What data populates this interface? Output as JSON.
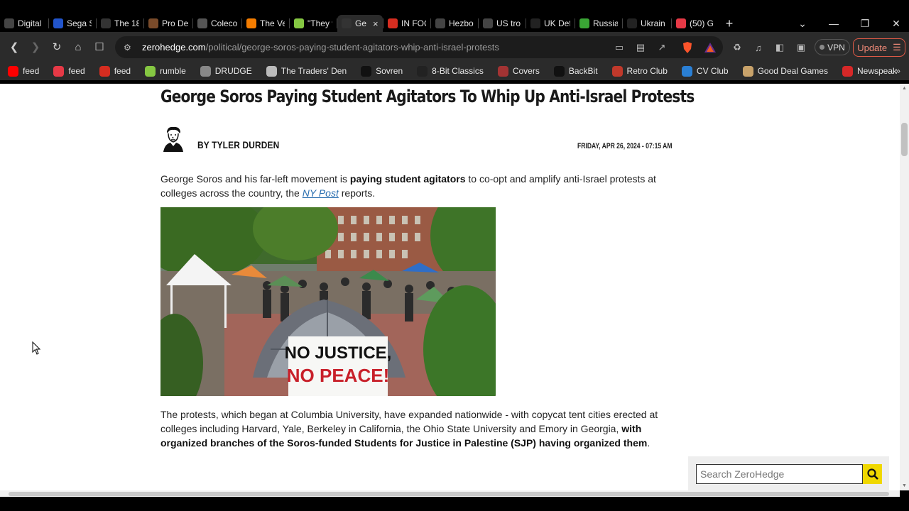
{
  "browser": {
    "tabs": [
      {
        "label": "Digital",
        "icon": "reader-icon",
        "color": "#444444"
      },
      {
        "label": "Sega S",
        "icon": "sega-icon",
        "color": "#2255cc"
      },
      {
        "label": "The 18",
        "icon": "bookmark-icon",
        "color": "#333333"
      },
      {
        "label": "Pro De",
        "icon": "image-icon",
        "color": "#7a4b2a"
      },
      {
        "label": "Coleco",
        "icon": "globe-icon",
        "color": "#555555"
      },
      {
        "label": "The Ve",
        "icon": "blogger-icon",
        "color": "#f57d00"
      },
      {
        "label": "\"They v",
        "icon": "rumble-icon",
        "color": "#85c742"
      },
      {
        "label": "Ge",
        "icon": "zerohedge-icon",
        "color": "#333333",
        "active": true
      },
      {
        "label": "IN FOC",
        "icon": "c-icon",
        "color": "#d62d20"
      },
      {
        "label": "Hezbo",
        "icon": "reader-icon",
        "color": "#444444"
      },
      {
        "label": "US tro",
        "icon": "reader-icon",
        "color": "#444444"
      },
      {
        "label": "UK Def",
        "icon": "dark-icon",
        "color": "#222222"
      },
      {
        "label": "Russia",
        "icon": "rt-icon",
        "color": "#3aa535"
      },
      {
        "label": "Ukrain",
        "icon": "dark-icon",
        "color": "#222222"
      },
      {
        "label": "(50) G",
        "icon": "gab-icon",
        "color": "#e63946"
      }
    ],
    "new_tab": "+",
    "close_tab": "×",
    "url_host": "zerohedge.com",
    "url_path": "/political/george-soros-paying-student-agitators-whip-anti-israel-protests",
    "vpn_label": "VPN",
    "update_label": "Update",
    "bookmarks": [
      {
        "label": "feed",
        "icon": "youtube-icon",
        "color": "#ff0000"
      },
      {
        "label": "feed",
        "icon": "gab-icon",
        "color": "#e63946"
      },
      {
        "label": "feed",
        "icon": "c-icon",
        "color": "#d62d20"
      },
      {
        "label": "rumble",
        "icon": "rumble-icon",
        "color": "#85c742"
      },
      {
        "label": "DRUDGE",
        "icon": "drudge-icon",
        "color": "#888888"
      },
      {
        "label": "The Traders' Den",
        "icon": "traders-icon",
        "color": "#bbbbbb"
      },
      {
        "label": "Sovren",
        "icon": "sovren-icon",
        "color": "#111111"
      },
      {
        "label": "8-Bit Classics",
        "icon": "joystick-icon",
        "color": "#222222"
      },
      {
        "label": "Covers",
        "icon": "covers-icon",
        "color": "#a33333"
      },
      {
        "label": "BackBit",
        "icon": "backbit-icon",
        "color": "#111111"
      },
      {
        "label": "Retro Club",
        "icon": "retro-icon",
        "color": "#c0392b"
      },
      {
        "label": "CV Club",
        "icon": "cv-icon",
        "color": "#2a7fd4"
      },
      {
        "label": "Good Deal Games",
        "icon": "gdg-icon",
        "color": "#c8a26a"
      },
      {
        "label": "Newspeak",
        "icon": "newspeak-icon",
        "color": "#d62828"
      }
    ],
    "bookmarks_more": "»"
  },
  "article": {
    "title": "George Soros Paying Student Agitators To Whip Up Anti-Israel Protests",
    "author": "BY TYLER DURDEN",
    "date": "FRIDAY, APR 26, 2024 - 07:15 AM",
    "p1_a": "George Soros and his far-left movement is ",
    "p1_b": "paying student agitators",
    "p1_c": " to co-opt and amplify anti-Israel protests at colleges across the country, the ",
    "p1_link": "NY Post",
    "p1_d": " reports.",
    "photo_sign_1": "NO JUSTICE,",
    "photo_sign_2": "NO PEACE!",
    "p2_a": "The protests, which began at Columbia University, have expanded nationwide - with copycat tent cities erected at colleges including Harvard, Yale, Berkeley in California, the Ohio State University and Emory in Georgia, ",
    "p2_b": "with organized branches of the Soros-funded Students for Justice in Palestine (SJP) having organized them",
    "p2_c": "."
  },
  "search": {
    "placeholder": "Search ZeroHedge"
  }
}
